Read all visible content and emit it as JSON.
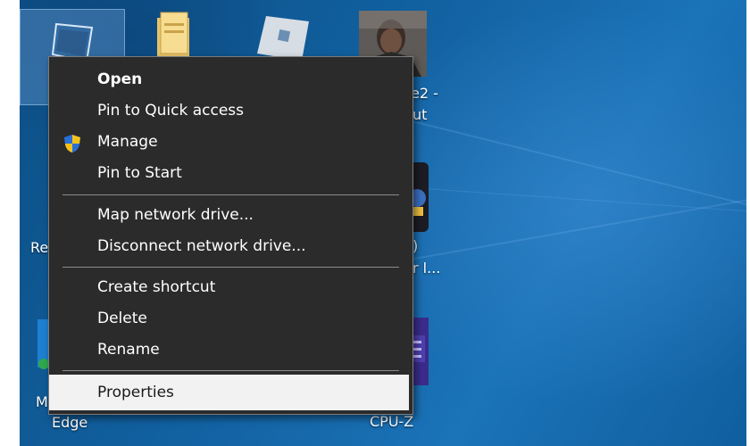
{
  "desktop": {
    "icons": [
      {
        "name": "this-pc-icon",
        "label": ""
      },
      {
        "name": "folder-icon",
        "label": ""
      },
      {
        "name": "roblox-icon",
        "label": ""
      },
      {
        "name": "photo-icon",
        "label": "e2 -\nut"
      },
      {
        "name": "recycle-bin-icon",
        "label": "Re"
      },
      {
        "name": "app-icon",
        "label": ")\nr l..."
      },
      {
        "name": "edge-icon",
        "label": "M\nEdge"
      },
      {
        "name": "cpuz-icon",
        "label": "CPU-Z"
      }
    ],
    "fragments": {
      "photo_label_1": "e2 -",
      "photo_label_2": "ut",
      "recycle_label": "Re",
      "app_label_1": ")",
      "app_label_2": "r l...",
      "edge_label_1": "M",
      "edge_label_2": "Edge",
      "cpuz_label": "CPU-Z"
    }
  },
  "context_menu": {
    "open": "Open",
    "pin_quick_access": "Pin to Quick access",
    "manage": "Manage",
    "pin_start": "Pin to Start",
    "map_drive": "Map network drive...",
    "disconnect_drive": "Disconnect network drive...",
    "create_shortcut": "Create shortcut",
    "delete": "Delete",
    "rename": "Rename",
    "properties": "Properties",
    "highlighted_item": "Properties"
  },
  "colors": {
    "desktop_blue": "#11609f",
    "menu_bg": "#2b2b2b",
    "menu_text": "#ffffff",
    "highlight_bg": "#f2f2f2",
    "shield_blue": "#2b6fd6",
    "shield_yellow": "#f2c21b"
  }
}
